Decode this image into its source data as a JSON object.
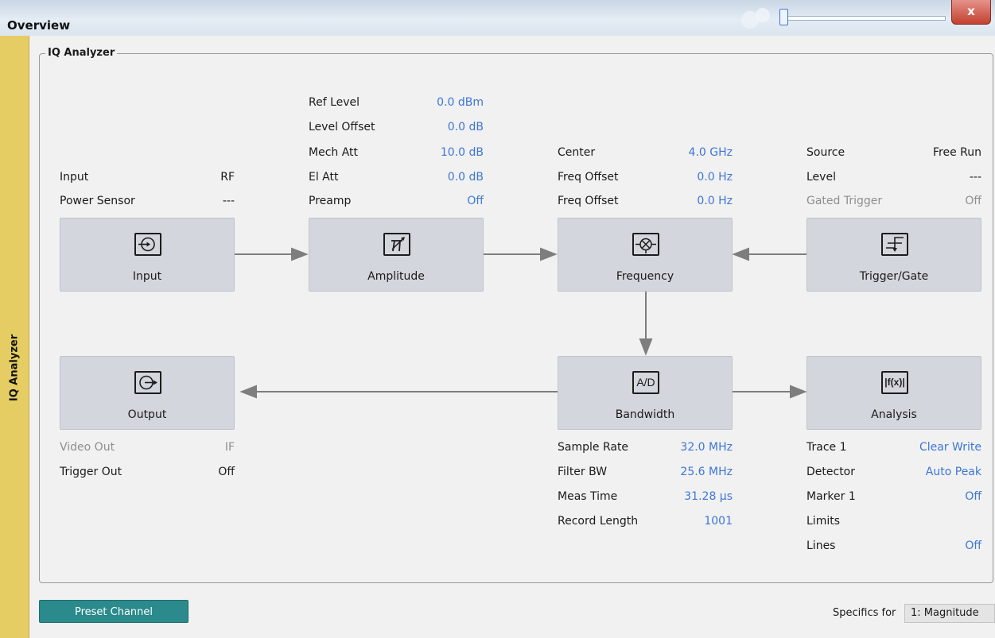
{
  "window": {
    "title": "Overview",
    "close_glyph": "x"
  },
  "side_tab": {
    "label": "IQ Analyzer"
  },
  "group": {
    "title": "IQ Analyzer"
  },
  "input_params": [
    {
      "label": "Input",
      "value": "RF",
      "disabled": false
    },
    {
      "label": "Power Sensor",
      "value": "---",
      "disabled": false
    }
  ],
  "amplitude_params": [
    {
      "label": "Ref Level",
      "value": "0.0 dBm"
    },
    {
      "label": "Level Offset",
      "value": "0.0 dB"
    },
    {
      "label": "Mech Att",
      "value": "10.0 dB"
    },
    {
      "label": "El Att",
      "value": "0.0 dB"
    },
    {
      "label": "Preamp",
      "value": "Off"
    }
  ],
  "frequency_params": [
    {
      "label": "Center",
      "value": "4.0 GHz"
    },
    {
      "label": "Freq Offset",
      "value": "0.0 Hz"
    },
    {
      "label": "Freq Offset",
      "value": "0.0 Hz"
    }
  ],
  "trigger_params": [
    {
      "label": "Source",
      "value": "Free Run"
    },
    {
      "label": "Level",
      "value": "---"
    },
    {
      "label": "Gated Trigger",
      "value": "Off"
    }
  ],
  "output_params": [
    {
      "label": "Video Out",
      "value": "IF"
    },
    {
      "label": "Trigger Out",
      "value": "Off"
    }
  ],
  "bandwidth_params": [
    {
      "label": "Sample Rate",
      "value": "32.0 MHz"
    },
    {
      "label": "Filter BW",
      "value": "25.6 MHz"
    },
    {
      "label": "Meas Time",
      "value": "31.28 µs"
    },
    {
      "label": "Record Length",
      "value": "1001"
    }
  ],
  "analysis_params": [
    {
      "label": "Trace 1",
      "value": "Clear Write"
    },
    {
      "label": "Detector",
      "value": "Auto Peak"
    },
    {
      "label": "Marker 1",
      "value": "Off"
    },
    {
      "label": "Limits",
      "value": ""
    },
    {
      "label": "Lines",
      "value": "Off"
    }
  ],
  "blocks": {
    "input": {
      "label": "Input",
      "icon": "input-icon"
    },
    "amplitude": {
      "label": "Amplitude",
      "icon": "attenuator-icon"
    },
    "frequency": {
      "label": "Frequency",
      "icon": "mixer-icon"
    },
    "trigger": {
      "label": "Trigger/Gate",
      "icon": "trigger-icon"
    },
    "output": {
      "label": "Output",
      "icon": "output-icon"
    },
    "bandwidth": {
      "label": "Bandwidth",
      "icon": "ad-converter-icon",
      "icon_text": "A/D"
    },
    "analysis": {
      "label": "Analysis",
      "icon": "analysis-icon",
      "icon_text": "|f(x)|"
    }
  },
  "footer": {
    "preset_label": "Preset Channel",
    "specifics_label": "Specifics for",
    "specifics_value": "1: Magnitude"
  },
  "colors": {
    "value_blue": "#3d76d8",
    "side_tab": "#e6cd63",
    "preset_button": "#2a8a8c",
    "block": "#d3d7dd"
  }
}
